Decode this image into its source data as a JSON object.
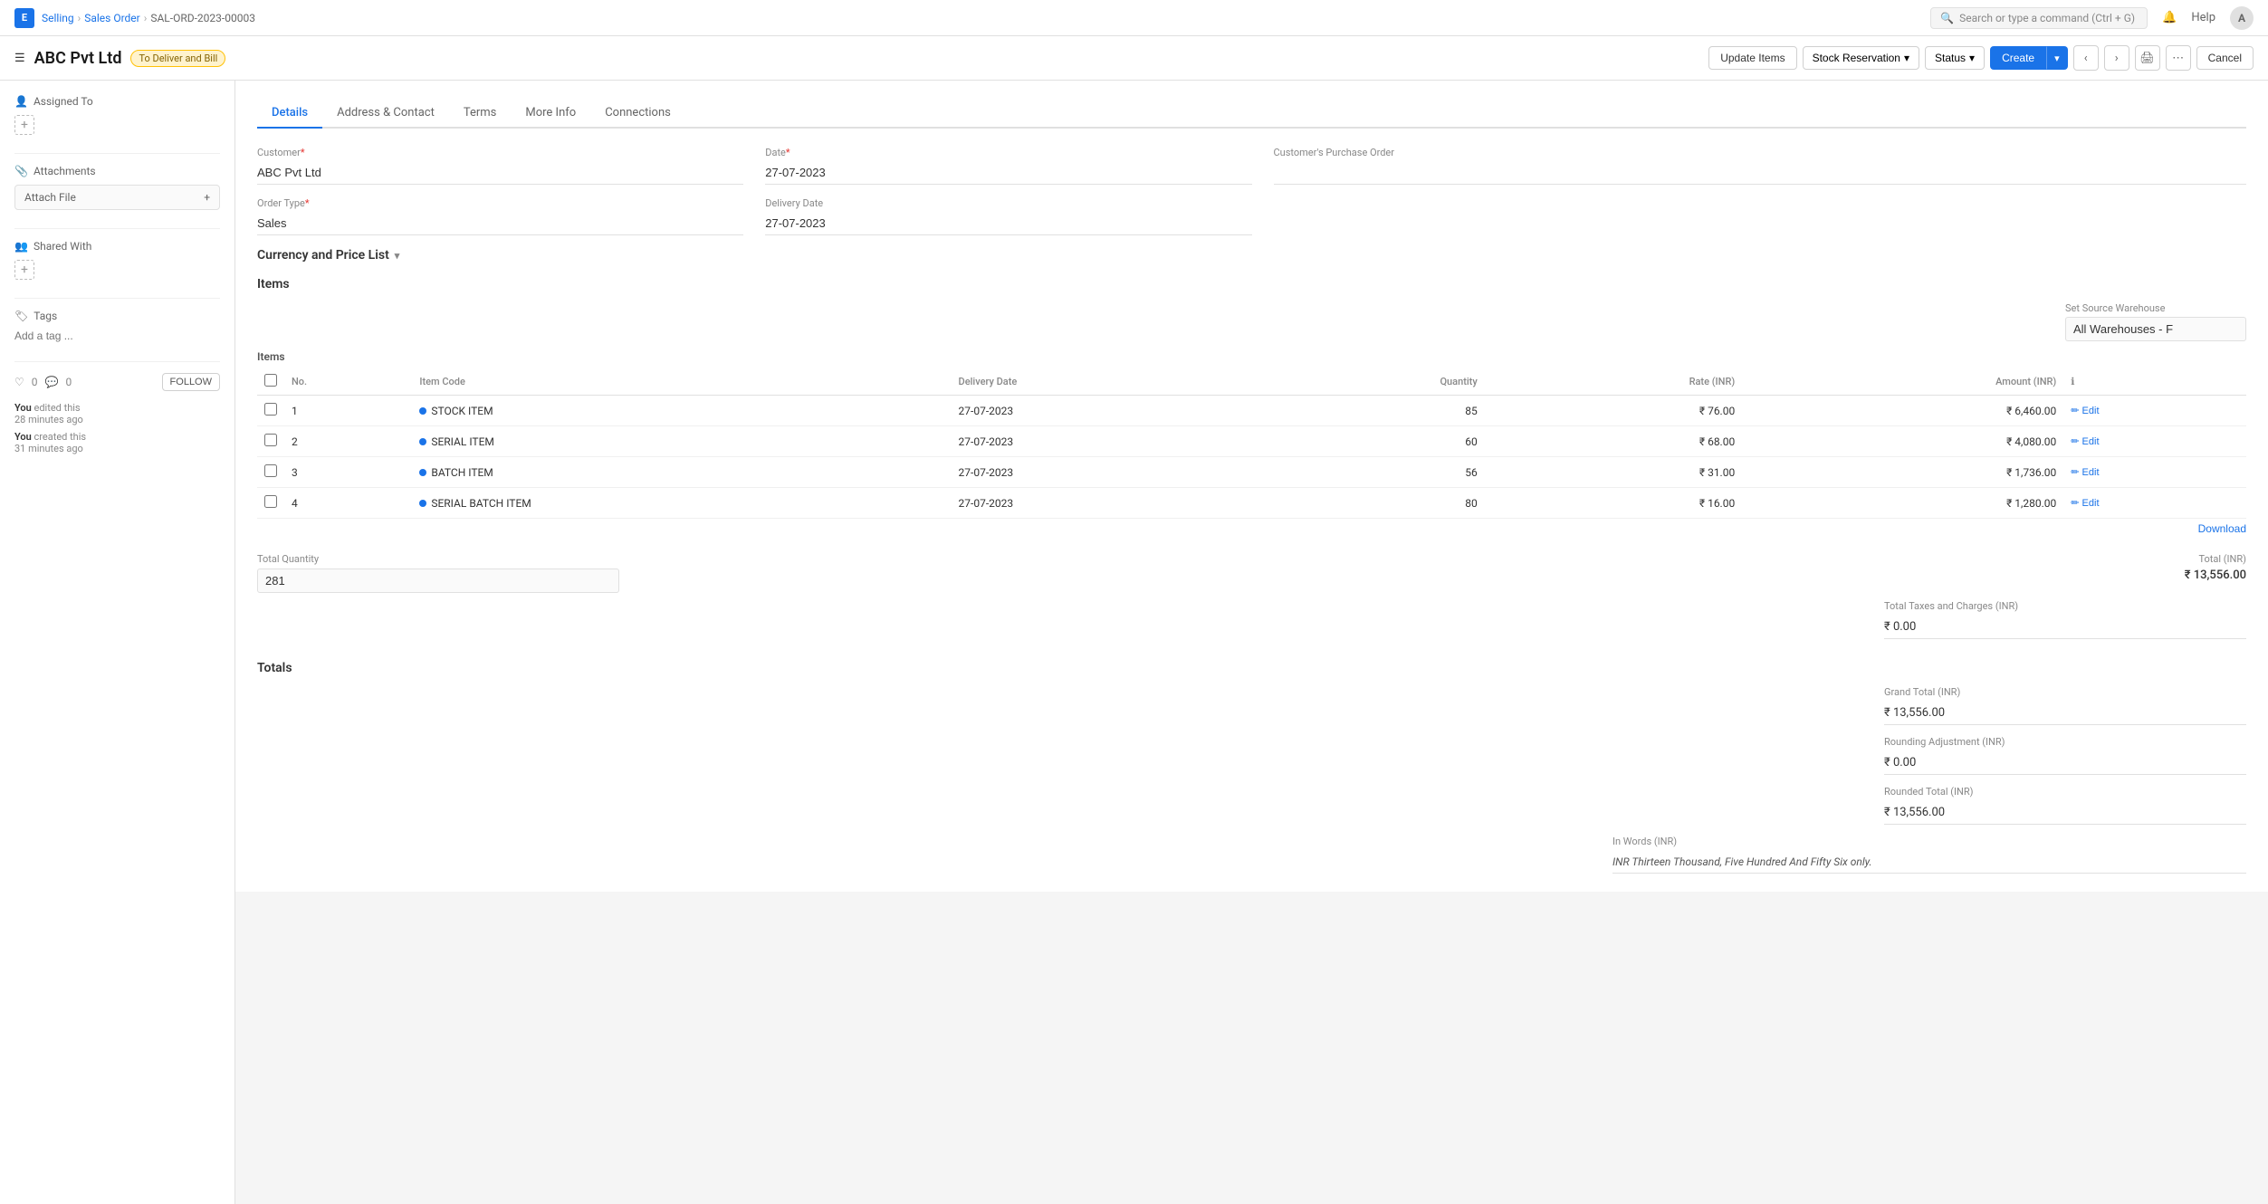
{
  "app": {
    "icon": "E",
    "breadcrumb": [
      "Selling",
      "Sales Order",
      "SAL-ORD-2023-00003"
    ]
  },
  "topnav": {
    "search_placeholder": "Search or type a command (Ctrl + G)",
    "help_label": "Help",
    "avatar_label": "A"
  },
  "document": {
    "title": "ABC Pvt Ltd",
    "badge": "To Deliver and Bill",
    "update_items_label": "Update Items",
    "stock_reservation_label": "Stock Reservation",
    "status_label": "Status",
    "create_label": "Create",
    "cancel_label": "Cancel"
  },
  "sidebar": {
    "assigned_to_label": "Assigned To",
    "attachments_label": "Attachments",
    "attach_file_label": "Attach File",
    "shared_with_label": "Shared With",
    "tags_label": "Tags",
    "add_tag_placeholder": "Add a tag ...",
    "reactions": {
      "likes": "0",
      "comments": "0"
    },
    "follow_label": "FOLLOW",
    "edited_by": "You",
    "edited_text": "edited this",
    "edited_time": "28 minutes ago",
    "created_by": "You",
    "created_text": "created this",
    "created_time": "31 minutes ago"
  },
  "tabs": [
    {
      "id": "details",
      "label": "Details",
      "active": true
    },
    {
      "id": "address",
      "label": "Address & Contact"
    },
    {
      "id": "terms",
      "label": "Terms"
    },
    {
      "id": "more_info",
      "label": "More Info"
    },
    {
      "id": "connections",
      "label": "Connections"
    }
  ],
  "form": {
    "customer_label": "Customer",
    "customer_value": "ABC Pvt Ltd",
    "date_label": "Date",
    "date_value": "27-07-2023",
    "customers_po_label": "Customer's Purchase Order",
    "customers_po_value": "",
    "order_type_label": "Order Type",
    "order_type_value": "Sales",
    "delivery_date_label": "Delivery Date",
    "delivery_date_value": "27-07-2023",
    "currency_section_label": "Currency and Price List",
    "items_section_label": "Items",
    "warehouse_label": "Set Source Warehouse",
    "warehouse_value": "All Warehouses - F",
    "items_table": {
      "columns": [
        "",
        "No.",
        "Item Code",
        "Delivery Date",
        "Quantity",
        "Rate (INR)",
        "Amount (INR)",
        ""
      ],
      "rows": [
        {
          "no": "1",
          "item_code": "STOCK ITEM",
          "dot_color": "blue",
          "delivery_date": "27-07-2023",
          "quantity": "85",
          "rate": "₹ 76.00",
          "amount": "₹ 6,460.00"
        },
        {
          "no": "2",
          "item_code": "SERIAL ITEM",
          "dot_color": "blue",
          "delivery_date": "27-07-2023",
          "quantity": "60",
          "rate": "₹ 68.00",
          "amount": "₹ 4,080.00"
        },
        {
          "no": "3",
          "item_code": "BATCH ITEM",
          "dot_color": "blue",
          "delivery_date": "27-07-2023",
          "quantity": "56",
          "rate": "₹ 31.00",
          "amount": "₹ 1,736.00"
        },
        {
          "no": "4",
          "item_code": "SERIAL BATCH ITEM",
          "dot_color": "blue",
          "delivery_date": "27-07-2023",
          "quantity": "80",
          "rate": "₹ 16.00",
          "amount": "₹ 1,280.00"
        }
      ]
    },
    "total_quantity_label": "Total Quantity",
    "total_quantity_value": "281",
    "total_inr_label": "Total (INR)",
    "total_inr_value": "₹ 13,556.00",
    "download_label": "Download",
    "edit_label": "Edit",
    "total_taxes_label": "Total Taxes and Charges (INR)",
    "total_taxes_value": "₹ 0.00",
    "totals_section_label": "Totals",
    "grand_total_label": "Grand Total (INR)",
    "grand_total_value": "₹ 13,556.00",
    "rounding_label": "Rounding Adjustment (INR)",
    "rounding_value": "₹ 0.00",
    "rounded_total_label": "Rounded Total (INR)",
    "rounded_total_value": "₹ 13,556.00",
    "in_words_label": "In Words (INR)",
    "in_words_value": "INR Thirteen Thousand, Five Hundred And Fifty Six only."
  }
}
